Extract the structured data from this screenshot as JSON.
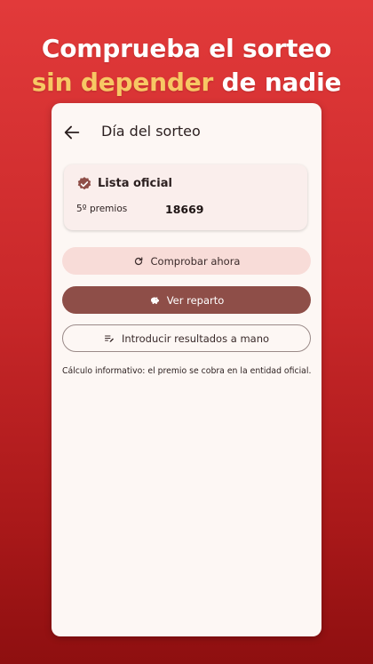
{
  "headline": {
    "line1": "Comprueba el sorteo",
    "line2_highlight": "sin depender",
    "line2_rest": " de nadie"
  },
  "appbar": {
    "back_icon": "arrow-left-icon",
    "title": "Día del sorteo"
  },
  "card": {
    "badge_icon": "verified-badge-icon",
    "title": "Lista oficial",
    "prize_label": "5º premios",
    "prize_number": "18669"
  },
  "buttons": {
    "check_label": "Comprobar ahora",
    "check_icon": "refresh-icon",
    "reparto_label": "Ver reparto",
    "reparto_icon": "piggy-bank-icon",
    "manual_label": "Introducir resultados a mano",
    "manual_icon": "edit-list-icon"
  },
  "note": "Cálculo informativo: el premio se cobra en la entidad oficial.",
  "colors": {
    "background_top": "#e23a3a",
    "background_bottom": "#8e0f10",
    "highlight": "#f7c864",
    "primary_button": "#8e4e48",
    "tonal_button": "#f8dcd8",
    "surface": "#fdf7f4"
  }
}
